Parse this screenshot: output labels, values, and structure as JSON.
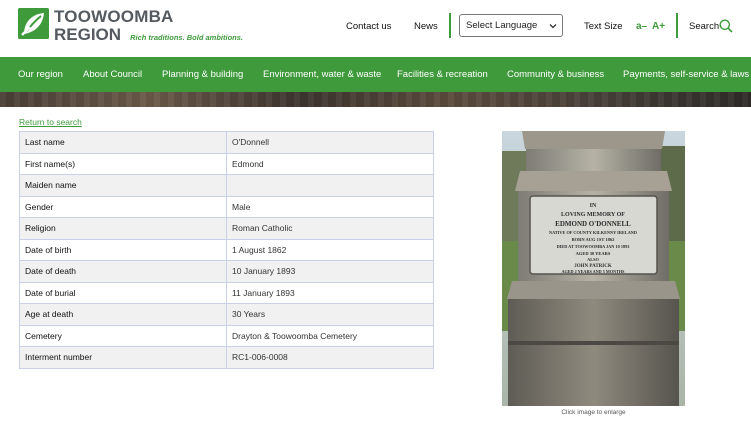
{
  "header": {
    "logo_line1": "TOOWOOMBA",
    "logo_line2": "REGION",
    "tagline": "Rich traditions. Bold ambitions.",
    "contact_label": "Contact us",
    "news_label": "News",
    "language_select": "Select Language",
    "text_size_label": "Text Size",
    "text_smaller": "a–",
    "text_larger": "A+",
    "search_label": "Search"
  },
  "nav": {
    "items": [
      "Our region",
      "About Council",
      "Planning & building",
      "Environment, water & waste",
      "Facilities & recreation",
      "Community & business",
      "Payments, self-service & laws"
    ]
  },
  "record": {
    "back_link": "Return to search",
    "rows": [
      {
        "key": "Last name",
        "value": "O'Donnell"
      },
      {
        "key": "First name(s)",
        "value": "Edmond"
      },
      {
        "key": "Maiden name",
        "value": ""
      },
      {
        "key": "Gender",
        "value": "Male"
      },
      {
        "key": "Religion",
        "value": "Roman Catholic"
      },
      {
        "key": "Date of birth",
        "value": "1 August 1862"
      },
      {
        "key": "Date of death",
        "value": "10 January 1893"
      },
      {
        "key": "Date of burial",
        "value": "11 January 1893"
      },
      {
        "key": "Age at death",
        "value": "30 Years"
      },
      {
        "key": "Cemetery",
        "value": "Drayton & Toowoomba Cemetery"
      },
      {
        "key": "Interment number",
        "value": "RC1-006-0008"
      }
    ]
  },
  "photo": {
    "caption": "Click image to enlarge",
    "plaque_lines": [
      "IN",
      "LOVING MEMORY OF",
      "EDMOND O'DONNELL",
      "NATIVE OF COUNTY KILKENNY IRELAND",
      "BORN AUG 1ST 1862",
      "DIED AT TOOWOOMBA JAN 10 1893",
      "AGED 30 YEARS",
      "ALSO",
      "JOHN PATRICK",
      "AGED 2 YEARS AND 5 MONTHS"
    ]
  },
  "colors": {
    "brand_green": "#3f9a3c",
    "logo_grey": "#545a5f"
  }
}
